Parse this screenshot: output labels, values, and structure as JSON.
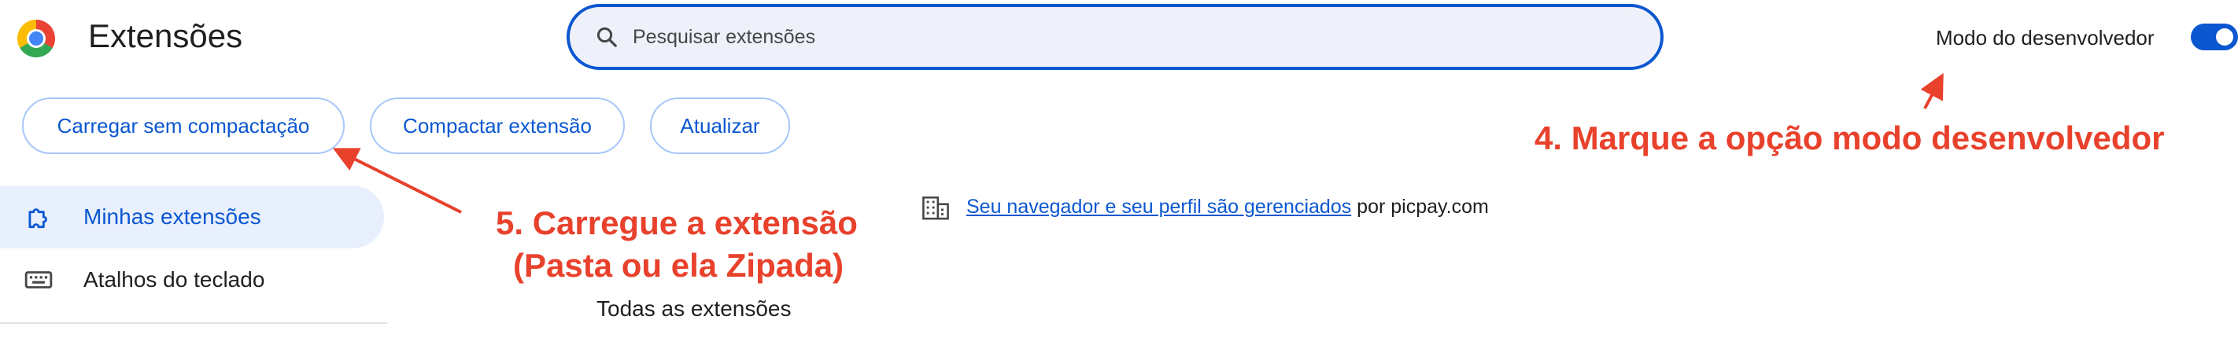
{
  "header": {
    "title": "Extensões",
    "search_placeholder": "Pesquisar extensões",
    "developer_mode_label": "Modo do desenvolvedor",
    "developer_mode_on": true
  },
  "toolbar": {
    "load_unpacked": "Carregar sem compactação",
    "pack_extension": "Compactar extensão",
    "update": "Atualizar"
  },
  "sidebar": {
    "items": [
      {
        "label": "Minhas extensões",
        "icon": "puzzle-icon",
        "selected": true
      },
      {
        "label": "Atalhos do teclado",
        "icon": "keyboard-icon",
        "selected": false
      }
    ]
  },
  "main": {
    "managed_link": "Seu navegador e seu perfil são gerenciados",
    "managed_suffix": " por picpay.com",
    "all_extensions": "Todas as extensões"
  },
  "annotations": {
    "step4": "4. Marque a opção modo desenvolvedor",
    "step5_line1": "5. Carregue a extensão",
    "step5_line2": "(Pasta ou ela Zipada)"
  },
  "colors": {
    "accent": "#0b57d0",
    "annotation": "#e8412c",
    "selected_bg": "#e8effd"
  }
}
